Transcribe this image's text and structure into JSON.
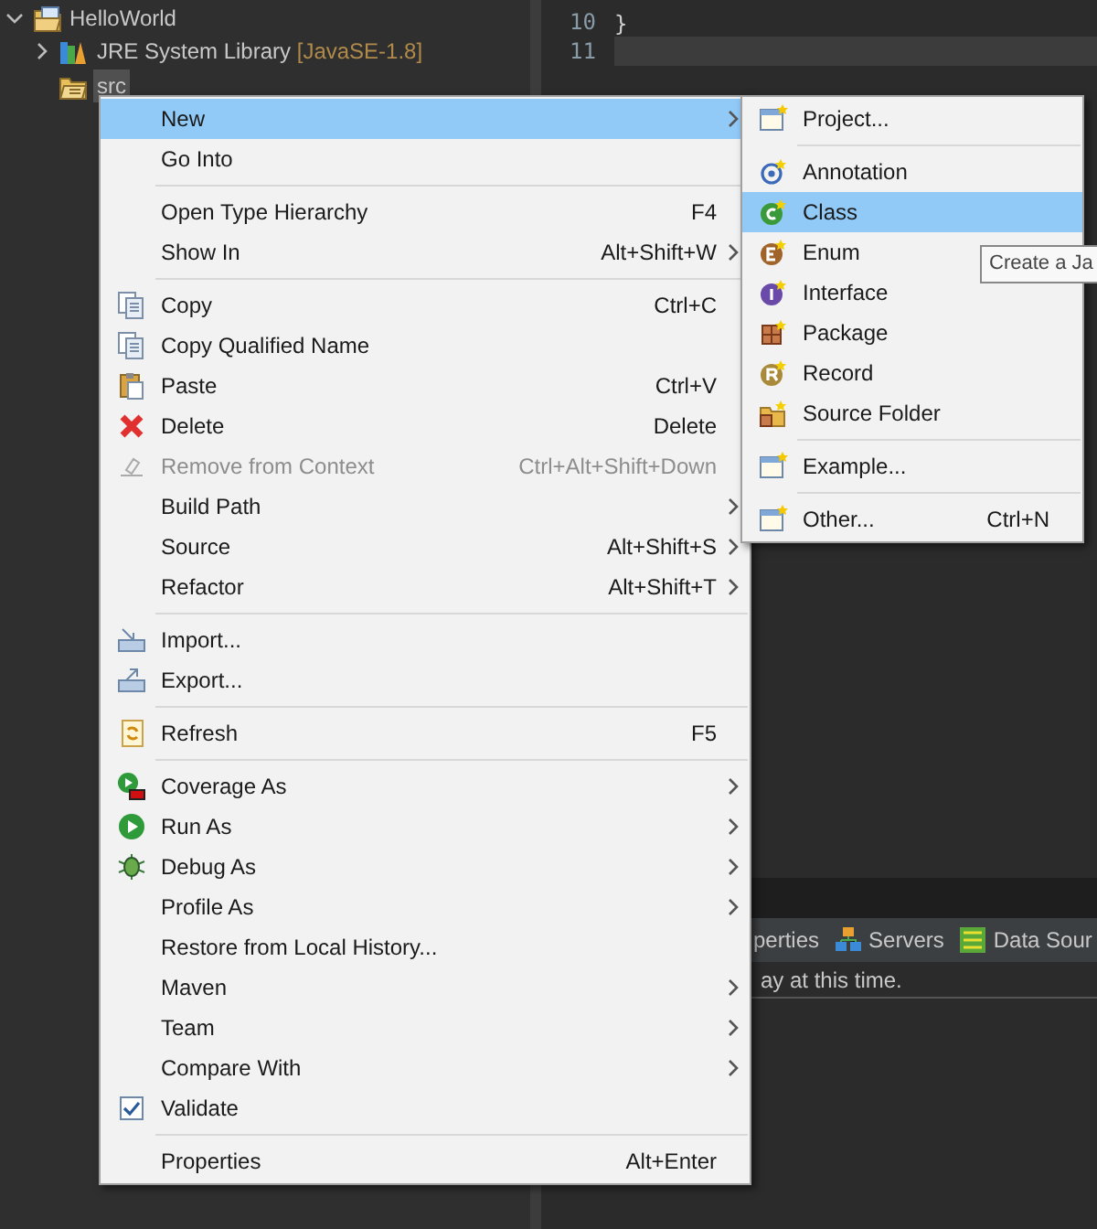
{
  "explorer": {
    "tree": [
      {
        "label": "HelloWorld",
        "expanded": true,
        "selected": false,
        "children": [
          {
            "label": "JRE System Library",
            "decoration": "[JavaSE-1.8]",
            "expanded": false,
            "selected": false
          },
          {
            "label": "src",
            "selected": true
          }
        ]
      }
    ]
  },
  "editor": {
    "lines": [
      {
        "number": "10",
        "code": "}",
        "current": false
      },
      {
        "number": "11",
        "current": true
      }
    ]
  },
  "bottom_panel": {
    "tabs": [
      {
        "label": "perties"
      },
      {
        "label": "Servers"
      },
      {
        "label": "Data Sour"
      }
    ],
    "message": "ay at this time."
  },
  "context_menu": {
    "items": [
      {
        "kind": "item",
        "label": "New",
        "selected": true,
        "disabled": false,
        "submenu": true
      },
      {
        "kind": "item",
        "label": "Go Into",
        "selected": false,
        "disabled": false,
        "submenu": false
      },
      {
        "kind": "separator"
      },
      {
        "kind": "item",
        "label": "Open Type Hierarchy",
        "shortcut": "F4",
        "selected": false,
        "disabled": false,
        "submenu": false
      },
      {
        "kind": "item",
        "label": "Show In",
        "shortcut": "Alt+Shift+W",
        "selected": false,
        "disabled": false,
        "submenu": true
      },
      {
        "kind": "separator"
      },
      {
        "kind": "item",
        "label": "Copy",
        "shortcut": "Ctrl+C",
        "selected": false,
        "disabled": false,
        "submenu": false
      },
      {
        "kind": "item",
        "label": "Copy Qualified Name",
        "selected": false,
        "disabled": false,
        "submenu": false
      },
      {
        "kind": "item",
        "label": "Paste",
        "shortcut": "Ctrl+V",
        "selected": false,
        "disabled": false,
        "submenu": false
      },
      {
        "kind": "item",
        "label": "Delete",
        "shortcut": "Delete",
        "selected": false,
        "disabled": false,
        "submenu": false
      },
      {
        "kind": "item",
        "label": "Remove from Context",
        "shortcut": "Ctrl+Alt+Shift+Down",
        "selected": false,
        "disabled": true,
        "submenu": false
      },
      {
        "kind": "item",
        "label": "Build Path",
        "selected": false,
        "disabled": false,
        "submenu": true
      },
      {
        "kind": "item",
        "label": "Source",
        "shortcut": "Alt+Shift+S",
        "selected": false,
        "disabled": false,
        "submenu": true
      },
      {
        "kind": "item",
        "label": "Refactor",
        "shortcut": "Alt+Shift+T",
        "selected": false,
        "disabled": false,
        "submenu": true
      },
      {
        "kind": "separator"
      },
      {
        "kind": "item",
        "label": "Import...",
        "selected": false,
        "disabled": false,
        "submenu": false
      },
      {
        "kind": "item",
        "label": "Export...",
        "selected": false,
        "disabled": false,
        "submenu": false
      },
      {
        "kind": "separator"
      },
      {
        "kind": "item",
        "label": "Refresh",
        "shortcut": "F5",
        "selected": false,
        "disabled": false,
        "submenu": false
      },
      {
        "kind": "separator"
      },
      {
        "kind": "item",
        "label": "Coverage As",
        "selected": false,
        "disabled": false,
        "submenu": true
      },
      {
        "kind": "item",
        "label": "Run As",
        "selected": false,
        "disabled": false,
        "submenu": true
      },
      {
        "kind": "item",
        "label": "Debug As",
        "selected": false,
        "disabled": false,
        "submenu": true
      },
      {
        "kind": "item",
        "label": "Profile As",
        "selected": false,
        "disabled": false,
        "submenu": true
      },
      {
        "kind": "item",
        "label": "Restore from Local History...",
        "selected": false,
        "disabled": false,
        "submenu": false
      },
      {
        "kind": "item",
        "label": "Maven",
        "selected": false,
        "disabled": false,
        "submenu": true
      },
      {
        "kind": "item",
        "label": "Team",
        "selected": false,
        "disabled": false,
        "submenu": true
      },
      {
        "kind": "item",
        "label": "Compare With",
        "selected": false,
        "disabled": false,
        "submenu": true
      },
      {
        "kind": "item",
        "label": "Validate",
        "selected": false,
        "disabled": false,
        "submenu": false
      },
      {
        "kind": "separator"
      },
      {
        "kind": "item",
        "label": "Properties",
        "shortcut": "Alt+Enter",
        "selected": false,
        "disabled": false,
        "submenu": false
      }
    ]
  },
  "submenu": {
    "items": [
      {
        "kind": "item",
        "label": "Project...",
        "selected": false
      },
      {
        "kind": "separator"
      },
      {
        "kind": "item",
        "label": "Annotation",
        "selected": false
      },
      {
        "kind": "item",
        "label": "Class",
        "selected": true
      },
      {
        "kind": "item",
        "label": "Enum",
        "selected": false
      },
      {
        "kind": "item",
        "label": "Interface",
        "selected": false
      },
      {
        "kind": "item",
        "label": "Package",
        "selected": false
      },
      {
        "kind": "item",
        "label": "Record",
        "selected": false
      },
      {
        "kind": "item",
        "label": "Source Folder",
        "selected": false
      },
      {
        "kind": "separator"
      },
      {
        "kind": "item",
        "label": "Example...",
        "selected": false
      },
      {
        "kind": "separator"
      },
      {
        "kind": "item",
        "label": "Other...",
        "shortcut": "Ctrl+N",
        "selected": false
      }
    ]
  },
  "tooltip": "Create a Ja"
}
